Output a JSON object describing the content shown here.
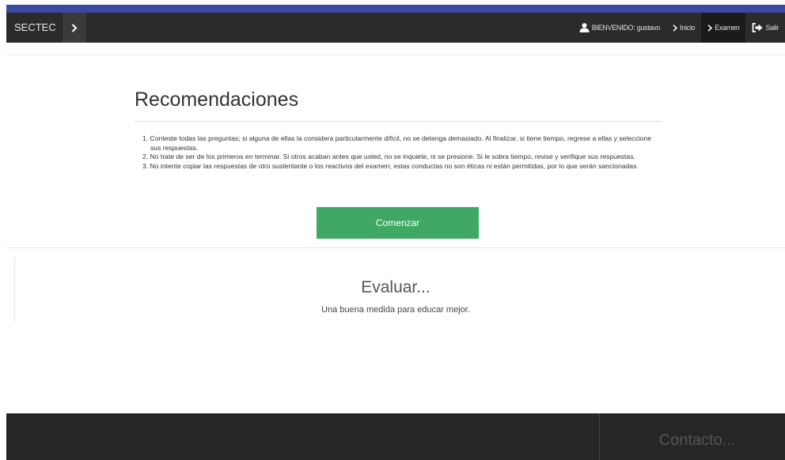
{
  "navbar": {
    "brand": "SECTEC",
    "brand_toggle_glyph": "›",
    "items": [
      {
        "icon": "user-icon",
        "label": "BIENVENIDO: gustavo"
      },
      {
        "icon": "chevron-right-icon",
        "label": "Inicio"
      },
      {
        "icon": "chevron-right-icon",
        "label": "Examen"
      },
      {
        "icon": "sign-out-icon",
        "label": "Salir"
      }
    ]
  },
  "main": {
    "title": "Recomendaciones",
    "recommendations": [
      "1. Conteste todas las preguntas; si alguna de ellas la considera particularmente difícil, no se detenga demasiado. Al finalizar, si tiene tiempo, regrese a ellas y seleccione sus respuestas.",
      "2. No trate de ser de los primeros en terminar. Si otros acaban antes que usted, no se inquiete, ni se presione. Si le sobra tiempo, revise y verifique sus respuestas.",
      "3. No intente copiar las respuestas de otro sustentante o los reactivos del examen; estas conductas no son éticas ni están permitidas, por lo que serán sancionadas."
    ],
    "start_button": "Comenzar"
  },
  "banner": {
    "heading": "Evaluar...",
    "tagline": "Una buena medida para educar mejor."
  },
  "footer": {
    "contact_heading": "Contacto..."
  },
  "colors": {
    "navbar_bg": "#2b2b2b",
    "top_bar": "#3a4aa0",
    "button": "#3fa864",
    "footer_bg": "#262626"
  }
}
